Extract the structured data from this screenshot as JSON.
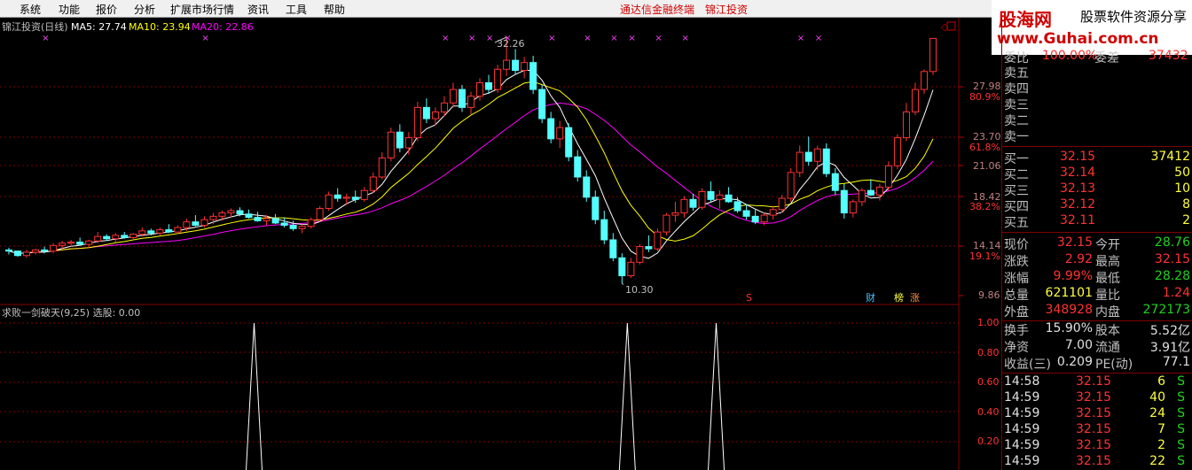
{
  "menu": [
    "系统",
    "功能",
    "报价",
    "分析",
    "扩展市场行情",
    "资讯",
    "工具",
    "帮助"
  ],
  "center_titles": [
    "通达信金融终端",
    "锦江投资"
  ],
  "logo": {
    "brand": "股海网",
    "slogan": "股票软件资源分享",
    "url": "www.Guhai.com.cn"
  },
  "chart": {
    "header": {
      "name": "锦江投资(日线)",
      "ma5": "MA5: 27.74",
      "ma10": "MA10: 23.94",
      "ma20": "MA20: 22.86"
    },
    "high_label": "32.26",
    "low_label": "10.30",
    "price_ticks": [
      "27.98",
      "23.70",
      "21.06",
      "18.42",
      "14.14",
      "9.86"
    ],
    "pct_ticks": [
      "80.9%",
      "61.8%",
      "38.2%",
      "19.1%"
    ],
    "markers": {
      "s": "S",
      "cai": "财",
      "bang": "榜",
      "zhang": "涨"
    },
    "colors": {
      "up": "#ff3232",
      "down": "#54ffff",
      "ma5": "#ffffff",
      "ma10": "#ffff00",
      "ma20": "#ff00ff",
      "grid": "#7f0000"
    }
  },
  "indicator": {
    "header": "求败一剑破天(9,25)  选股: 0.00",
    "ticks": [
      "1.00",
      "0.80",
      "0.60",
      "0.40",
      "0.20"
    ]
  },
  "quote": {
    "top_partial": {
      "l1": "委比",
      "v1": "100.00%",
      "l2": "委差",
      "v2": "37432"
    },
    "sells": [
      "卖五",
      "卖四",
      "卖三",
      "卖二",
      "卖一"
    ],
    "buys": [
      {
        "label": "买一",
        "price": "32.15",
        "vol": "37412"
      },
      {
        "label": "买二",
        "price": "32.14",
        "vol": "50"
      },
      {
        "label": "买三",
        "price": "32.13",
        "vol": "10"
      },
      {
        "label": "买四",
        "price": "32.12",
        "vol": "8"
      },
      {
        "label": "买五",
        "price": "32.11",
        "vol": "2"
      }
    ],
    "stats": [
      {
        "l1": "现价",
        "v1": "32.15",
        "c1": "red",
        "l2": "今开",
        "v2": "28.76",
        "c2": "grn"
      },
      {
        "l1": "涨跌",
        "v1": "2.92",
        "c1": "red",
        "l2": "最高",
        "v2": "32.15",
        "c2": "red"
      },
      {
        "l1": "涨幅",
        "v1": "9.99%",
        "c1": "red",
        "l2": "最低",
        "v2": "28.28",
        "c2": "grn"
      },
      {
        "l1": "总量",
        "v1": "621101",
        "c1": "ylw",
        "l2": "量比",
        "v2": "1.24",
        "c2": "red"
      },
      {
        "l1": "外盘",
        "v1": "348928",
        "c1": "red",
        "l2": "内盘",
        "v2": "272173",
        "c2": "grn"
      }
    ],
    "stats2": [
      {
        "l1": "换手",
        "v1": "15.90%",
        "l2": "股本",
        "v2": "5.52亿"
      },
      {
        "l1": "净资",
        "v1": "7.00",
        "l2": "流通",
        "v2": "3.91亿"
      },
      {
        "l1": "收益(三)",
        "v1": "0.209",
        "l2": "PE(动)",
        "v2": "77.1"
      }
    ],
    "ticks": [
      {
        "time": "14:58",
        "price": "32.15",
        "vol": "6",
        "side": "S"
      },
      {
        "time": "14:59",
        "price": "32.15",
        "vol": "40",
        "side": "S"
      },
      {
        "time": "14:59",
        "price": "32.15",
        "vol": "24",
        "side": "S"
      },
      {
        "time": "14:59",
        "price": "32.15",
        "vol": "7",
        "side": "S"
      },
      {
        "time": "14:59",
        "price": "32.15",
        "vol": "2",
        "side": "S"
      },
      {
        "time": "14:59",
        "price": "32.15",
        "vol": "22",
        "side": "S"
      }
    ]
  },
  "chart_data": {
    "type": "candlestick",
    "y_range": [
      9.86,
      32.26
    ],
    "candles": [
      [
        13.3,
        13.5,
        12.9,
        13.2
      ],
      [
        13.2,
        13.2,
        12.7,
        12.8
      ],
      [
        12.8,
        13.3,
        12.6,
        13.1
      ],
      [
        13.1,
        13.4,
        12.9,
        13.3
      ],
      [
        13.3,
        13.6,
        13.0,
        13.2
      ],
      [
        13.2,
        13.9,
        13.0,
        13.7
      ],
      [
        13.7,
        14.1,
        13.4,
        13.9
      ],
      [
        13.9,
        14.2,
        13.6,
        14.0
      ],
      [
        14.0,
        14.4,
        13.7,
        13.8
      ],
      [
        13.8,
        14.2,
        13.5,
        14.1
      ],
      [
        14.1,
        14.9,
        13.9,
        14.5
      ],
      [
        14.5,
        14.7,
        14.1,
        14.3
      ],
      [
        14.3,
        14.8,
        14.0,
        14.6
      ],
      [
        14.6,
        14.9,
        14.3,
        14.4
      ],
      [
        14.4,
        14.8,
        14.2,
        14.7
      ],
      [
        14.7,
        15.3,
        14.5,
        15.0
      ],
      [
        15.0,
        15.2,
        14.6,
        14.8
      ],
      [
        14.8,
        15.3,
        14.6,
        15.1
      ],
      [
        15.1,
        15.6,
        14.8,
        14.9
      ],
      [
        14.9,
        15.5,
        14.7,
        15.3
      ],
      [
        15.3,
        16.1,
        15.0,
        15.8
      ],
      [
        15.8,
        16.4,
        15.4,
        15.5
      ],
      [
        15.5,
        16.3,
        15.3,
        16.0
      ],
      [
        16.0,
        16.6,
        15.6,
        16.3
      ],
      [
        16.3,
        16.8,
        15.9,
        16.6
      ],
      [
        16.6,
        17.0,
        16.2,
        16.8
      ],
      [
        16.8,
        17.1,
        16.3,
        16.5
      ],
      [
        16.5,
        16.9,
        16.1,
        16.2
      ],
      [
        16.2,
        16.7,
        15.8,
        15.9
      ],
      [
        15.9,
        16.4,
        15.5,
        16.1
      ],
      [
        16.1,
        16.5,
        15.6,
        15.7
      ],
      [
        15.7,
        16.2,
        15.3,
        15.5
      ],
      [
        15.5,
        15.9,
        15.0,
        15.2
      ],
      [
        15.2,
        15.6,
        14.8,
        15.4
      ],
      [
        15.4,
        16.2,
        15.2,
        16.0
      ],
      [
        16.0,
        17.2,
        15.8,
        17.0
      ],
      [
        17.0,
        18.5,
        16.8,
        18.2
      ],
      [
        18.2,
        18.8,
        17.6,
        17.9
      ],
      [
        17.9,
        18.3,
        17.3,
        18.0
      ],
      [
        18.0,
        18.6,
        17.5,
        17.8
      ],
      [
        17.8,
        18.9,
        17.6,
        18.6
      ],
      [
        18.6,
        20.2,
        18.4,
        19.8
      ],
      [
        19.8,
        22.0,
        19.6,
        21.5
      ],
      [
        21.5,
        24.2,
        21.2,
        23.8
      ],
      [
        23.8,
        24.5,
        22.0,
        22.4
      ],
      [
        22.4,
        23.8,
        21.8,
        23.3
      ],
      [
        23.3,
        26.5,
        23.0,
        26.0
      ],
      [
        26.0,
        26.8,
        24.6,
        25.0
      ],
      [
        25.0,
        26.0,
        24.4,
        25.6
      ],
      [
        25.6,
        27.0,
        25.2,
        26.4
      ],
      [
        26.4,
        28.2,
        26.0,
        27.6
      ],
      [
        27.6,
        28.0,
        25.6,
        26.0
      ],
      [
        26.0,
        27.4,
        25.4,
        27.0
      ],
      [
        27.0,
        28.6,
        26.6,
        28.2
      ],
      [
        28.2,
        28.9,
        27.2,
        27.6
      ],
      [
        27.6,
        29.8,
        27.3,
        29.4
      ],
      [
        29.4,
        32.26,
        28.8,
        30.2
      ],
      [
        30.2,
        31.2,
        28.9,
        29.3
      ],
      [
        29.3,
        30.5,
        28.6,
        30.0
      ],
      [
        30.0,
        30.6,
        27.2,
        27.6
      ],
      [
        27.6,
        28.0,
        24.6,
        25.0
      ],
      [
        25.0,
        25.6,
        22.8,
        23.2
      ],
      [
        23.2,
        24.8,
        22.4,
        24.2
      ],
      [
        24.2,
        24.6,
        21.2,
        21.6
      ],
      [
        21.6,
        22.2,
        19.4,
        19.8
      ],
      [
        19.8,
        20.4,
        17.6,
        18.0
      ],
      [
        18.0,
        18.6,
        15.6,
        16.0
      ],
      [
        16.0,
        16.8,
        13.8,
        14.2
      ],
      [
        14.2,
        14.8,
        12.3,
        12.6
      ],
      [
        12.6,
        13.0,
        10.3,
        11.0
      ],
      [
        11.0,
        12.6,
        10.8,
        12.2
      ],
      [
        12.2,
        13.8,
        12.0,
        13.6
      ],
      [
        13.6,
        14.6,
        13.1,
        13.4
      ],
      [
        13.4,
        15.2,
        13.2,
        14.9
      ],
      [
        14.9,
        16.6,
        14.6,
        16.4
      ],
      [
        16.4,
        17.6,
        15.8,
        16.6
      ],
      [
        16.6,
        18.1,
        16.2,
        17.8
      ],
      [
        17.8,
        18.3,
        16.8,
        17.1
      ],
      [
        17.1,
        18.8,
        16.9,
        18.5
      ],
      [
        18.5,
        19.4,
        17.6,
        17.8
      ],
      [
        17.8,
        18.6,
        17.0,
        18.2
      ],
      [
        18.2,
        18.9,
        17.5,
        17.6
      ],
      [
        17.6,
        18.0,
        16.6,
        16.8
      ],
      [
        16.8,
        17.4,
        16.0,
        16.3
      ],
      [
        16.3,
        16.9,
        15.6,
        15.8
      ],
      [
        15.8,
        16.6,
        15.5,
        16.4
      ],
      [
        16.4,
        17.2,
        16.0,
        16.9
      ],
      [
        16.9,
        18.2,
        16.6,
        17.9
      ],
      [
        17.9,
        20.6,
        17.6,
        20.2
      ],
      [
        20.2,
        22.6,
        19.8,
        22.0
      ],
      [
        22.0,
        23.4,
        20.8,
        21.2
      ],
      [
        21.2,
        22.6,
        20.4,
        22.3
      ],
      [
        22.3,
        22.8,
        19.8,
        20.1
      ],
      [
        20.1,
        20.6,
        18.2,
        18.6
      ],
      [
        18.6,
        19.2,
        16.1,
        16.6
      ],
      [
        16.6,
        17.8,
        16.2,
        17.6
      ],
      [
        17.6,
        18.8,
        17.2,
        18.6
      ],
      [
        18.6,
        19.6,
        18.1,
        18.2
      ],
      [
        18.2,
        19.2,
        17.7,
        18.9
      ],
      [
        18.9,
        21.2,
        18.6,
        20.8
      ],
      [
        20.8,
        23.6,
        20.5,
        23.3
      ],
      [
        23.3,
        26.4,
        23.0,
        25.6
      ],
      [
        25.6,
        28.2,
        25.3,
        27.6
      ],
      [
        27.6,
        29.4,
        27.2,
        29.2
      ],
      [
        29.2,
        32.15,
        28.9,
        32.15
      ]
    ],
    "indicator_signals": [
      {
        "index": 27,
        "value": 1.0
      },
      {
        "index": 69,
        "value": 1.0
      },
      {
        "index": 79,
        "value": 1.0
      }
    ]
  }
}
